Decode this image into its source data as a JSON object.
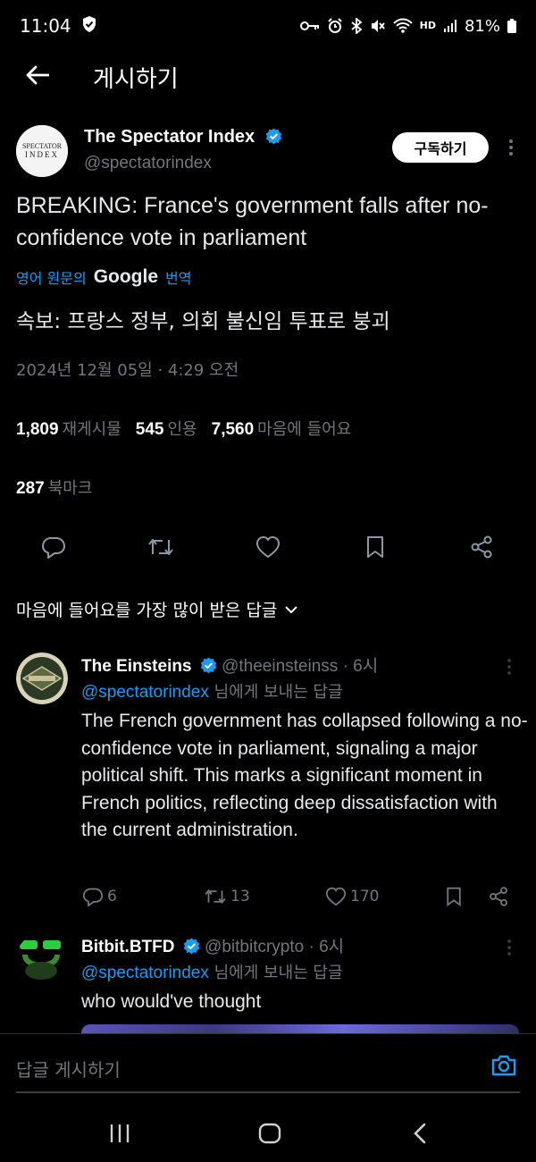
{
  "status_bar": {
    "time": "11:04",
    "battery": "81%",
    "icons": [
      "shield-check-icon",
      "key-icon",
      "alarm-icon",
      "bluetooth-icon",
      "mute-icon",
      "wifi-icon",
      "hd-voice-icon",
      "signal-icon",
      "battery-icon"
    ],
    "hd_label": "HD"
  },
  "topbar": {
    "title": "게시하기"
  },
  "post": {
    "author_name": "The Spectator Index",
    "author_handle": "@spectatorindex",
    "avatar_text_top": "SPECTATOR",
    "avatar_text_bottom": "INDEX",
    "subscribe_label": "구독하기",
    "text": "BREAKING: France's government falls after no-confidence vote in parliament",
    "translate_prefix": "영어 원문의",
    "translate_brand": "Google",
    "translate_suffix": "번역",
    "translated_text": "속보: 프랑스 정부, 의회 불신임 투표로 붕괴",
    "timestamp": "2024년 12월 05일 · 4:29 오전",
    "stats": {
      "reposts_count": "1,809",
      "reposts_label": "재게시물",
      "quotes_count": "545",
      "quotes_label": "인용",
      "likes_count": "7,560",
      "likes_label": "마음에 들어요",
      "bookmarks_count": "287",
      "bookmarks_label": "북마크"
    }
  },
  "sort": {
    "label": "마음에 들어요를 가장 많이 받은 답글"
  },
  "replies": [
    {
      "name": "The Einsteins",
      "handle": "@theeinsteinss",
      "time": "· 6시",
      "reply_to_mention": "@spectatorindex",
      "reply_to_suffix": "님에게 보내는 답글",
      "body": "The French government has collapsed following a no-confidence vote in parliament, signaling a major political shift. This marks a significant moment in French politics, reflecting deep dissatisfaction with the current administration.",
      "replies_count": "6",
      "reposts_count": "13",
      "likes_count": "170"
    },
    {
      "name": "Bitbit.BTFD",
      "handle": "@bitbitcrypto",
      "time": "· 6시",
      "reply_to_mention": "@spectatorindex",
      "reply_to_suffix": "님에게 보내는 답글",
      "body": "who would've thought"
    }
  ],
  "compose": {
    "placeholder": "답글 게시하기"
  },
  "colors": {
    "accent": "#1d9bf0",
    "muted": "#71767b",
    "background": "#000000"
  }
}
